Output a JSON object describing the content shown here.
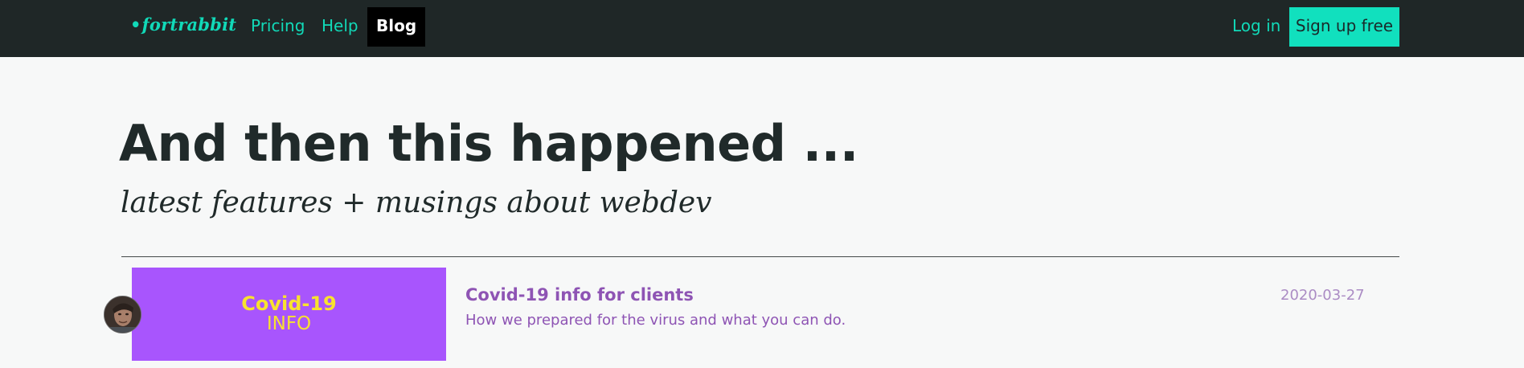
{
  "header": {
    "logo_dot": "•",
    "logo_text": "fortrabbit",
    "nav": [
      {
        "label": "Pricing"
      },
      {
        "label": "Help"
      },
      {
        "label": "Blog"
      }
    ],
    "login_label": "Log in",
    "signup_label": "Sign up free"
  },
  "hero": {
    "title": "And then this happened ...",
    "subtitle": "latest features + musings about webdev"
  },
  "posts": [
    {
      "thumbnail_title": "Covid-19",
      "thumbnail_subtitle": "INFO",
      "title": "Covid-19 info for clients",
      "excerpt": "How we prepared for the virus and what you can do.",
      "date": "2020-03-27"
    }
  ],
  "colors": {
    "topbar": "#1f2727",
    "accent": "#11d9b8",
    "signup_bg": "#11e0be",
    "post_text": "#8e54b4",
    "thumb_bg": "#a855fd",
    "thumb_text": "#f8e22e"
  }
}
